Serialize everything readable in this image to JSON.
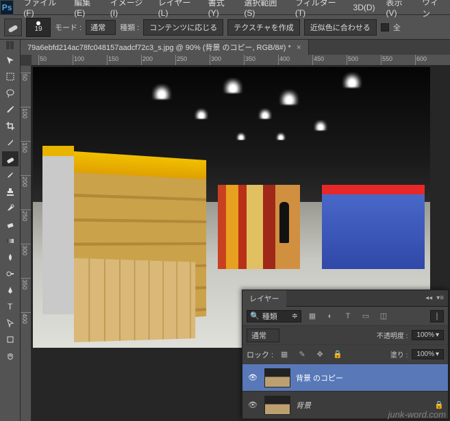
{
  "app_logo": "Ps",
  "menu": [
    "ファイル(F)",
    "編集(E)",
    "イメージ(I)",
    "レイヤー(L)",
    "書式(Y)",
    "選択範囲(S)",
    "フィルター(T)",
    "3D(D)",
    "表示(V)",
    "ウィン"
  ],
  "options": {
    "brush_size": "19",
    "mode_label": "モード :",
    "mode_value": "通常",
    "type_label": "種類 :",
    "btn_content": "コンテンツに応じる",
    "btn_texture": "テクスチャを作成",
    "btn_proximity": "近似色に合わせる",
    "check_all": "全"
  },
  "document": {
    "tab_title": "79a6ebfd214ac78fc048157aadcf72c3_s.jpg @ 90% (背景 のコピー, RGB/8#) *"
  },
  "ruler_h": [
    "50",
    "100",
    "150",
    "200",
    "250",
    "300",
    "350",
    "400",
    "450",
    "500",
    "550",
    "600"
  ],
  "ruler_v": [
    "50",
    "100",
    "150",
    "200",
    "250",
    "300",
    "350",
    "400"
  ],
  "layers_panel": {
    "title": "レイヤー",
    "search_placeholder": "種類",
    "blend_mode": "通常",
    "opacity_label": "不透明度 :",
    "opacity_value": "100%",
    "lock_label": "ロック :",
    "fill_label": "塗り :",
    "fill_value": "100%",
    "layers": [
      {
        "name": "背景 のコピー",
        "selected": true
      },
      {
        "name": "背景",
        "selected": false
      }
    ]
  },
  "watermark": "junk-word.com"
}
